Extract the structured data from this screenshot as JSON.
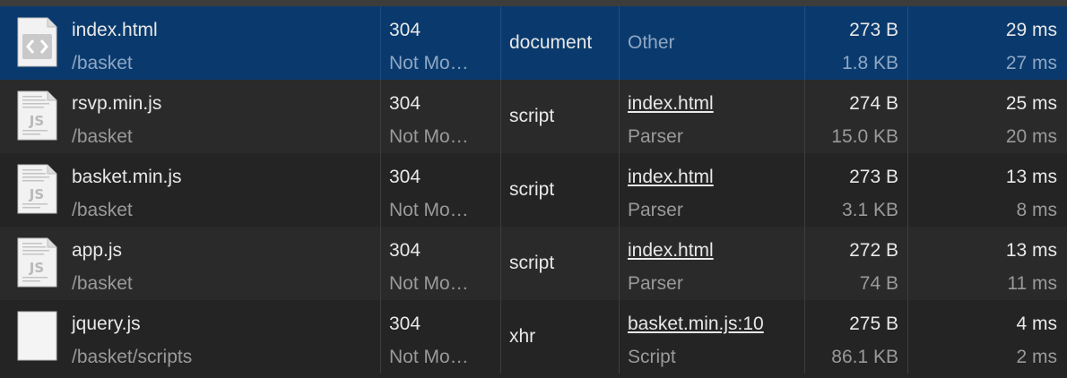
{
  "rows": [
    {
      "icon": "html-file-icon",
      "name": "index.html",
      "path": "/basket",
      "status_code": "304",
      "status_text": "Not Mo…",
      "type": "document",
      "initiator": "Other",
      "initiator_detail": "",
      "size_transferred": "273 B",
      "size_resource": "1.8 KB",
      "time_total": "29 ms",
      "time_latency": "27 ms"
    },
    {
      "icon": "js-file-icon",
      "name": "rsvp.min.js",
      "path": "/basket",
      "status_code": "304",
      "status_text": "Not Mo…",
      "type": "script",
      "initiator": "index.html",
      "initiator_detail": "Parser",
      "size_transferred": "274 B",
      "size_resource": "15.0 KB",
      "time_total": "25 ms",
      "time_latency": "20 ms"
    },
    {
      "icon": "js-file-icon",
      "name": "basket.min.js",
      "path": "/basket",
      "status_code": "304",
      "status_text": "Not Mo…",
      "type": "script",
      "initiator": "index.html",
      "initiator_detail": "Parser",
      "size_transferred": "273 B",
      "size_resource": "3.1 KB",
      "time_total": "13 ms",
      "time_latency": "8 ms"
    },
    {
      "icon": "js-file-icon",
      "name": "app.js",
      "path": "/basket",
      "status_code": "304",
      "status_text": "Not Mo…",
      "type": "script",
      "initiator": "index.html",
      "initiator_detail": "Parser",
      "size_transferred": "272 B",
      "size_resource": "74 B",
      "time_total": "13 ms",
      "time_latency": "11 ms"
    },
    {
      "icon": "blank-file-icon",
      "name": "jquery.js",
      "path": "/basket/scripts",
      "status_code": "304",
      "status_text": "Not Mo…",
      "type": "xhr",
      "initiator": "basket.min.js:10",
      "initiator_detail": "Script",
      "size_transferred": "275 B",
      "size_resource": "86.1 KB",
      "time_total": "4 ms",
      "time_latency": "2 ms"
    }
  ],
  "colors": {
    "selected_row": "#0a3a6d",
    "row_odd": "#2a2a2a",
    "row_even": "#242424",
    "text_primary": "#e8e8e8",
    "text_secondary": "#9a9a9a"
  }
}
